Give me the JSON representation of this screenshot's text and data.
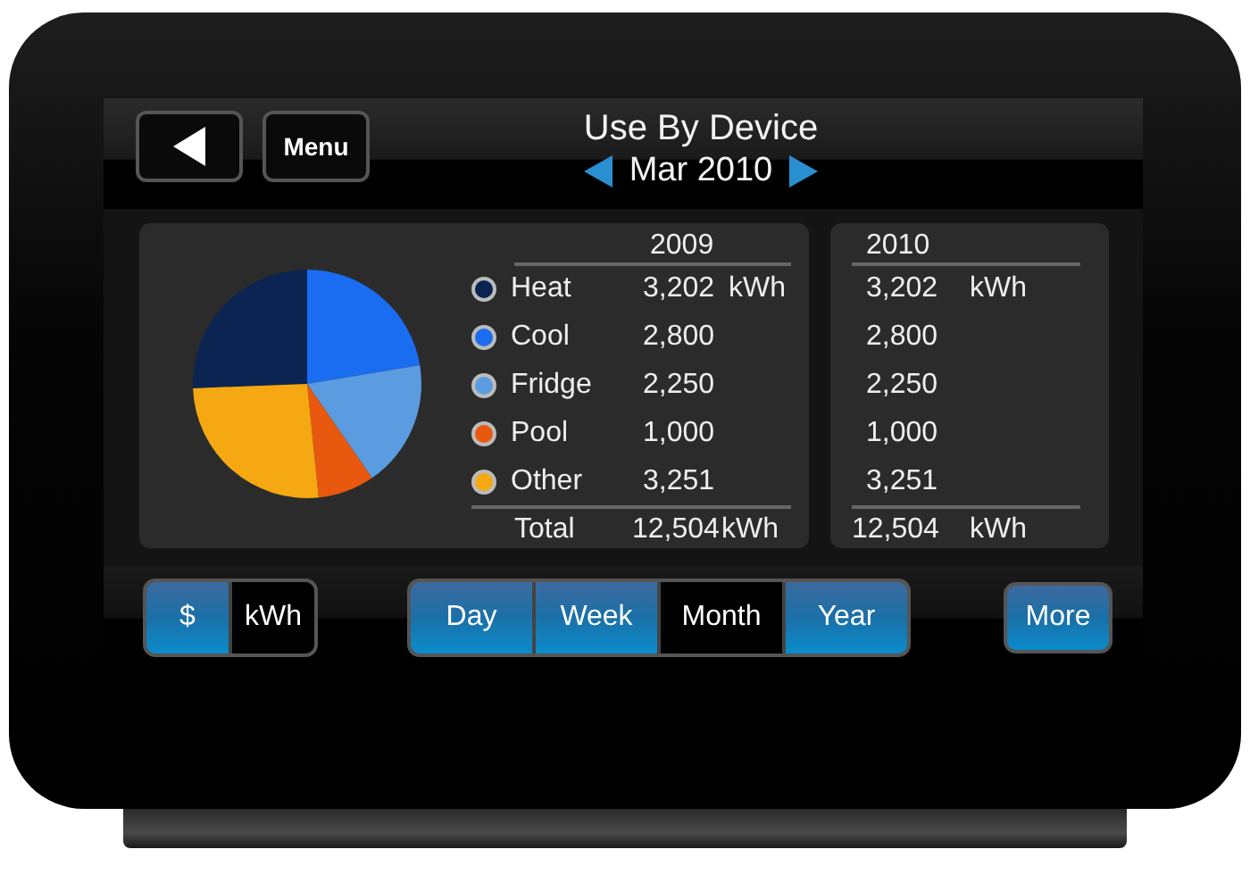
{
  "header": {
    "menu_button": "Menu",
    "title": "Use By Device",
    "period": "Mar 2010"
  },
  "breakdown": {
    "chart_data": {
      "type": "pie",
      "categories": [
        "Heat",
        "Cool",
        "Fridge",
        "Pool",
        "Other"
      ],
      "values": [
        25.61,
        22.39,
        18.0,
        8.0,
        26.0
      ]
    },
    "columns": [
      "2009",
      "2010"
    ],
    "rows": [
      {
        "color": "#0b2452",
        "values": [
          "3,202",
          "3,202"
        ],
        "units": [
          "kWh",
          "kWh"
        ]
      },
      {
        "color": "#1a6cf0",
        "values": [
          "2,800",
          "2,800"
        ]
      },
      {
        "color": "#5b9be0",
        "values": [
          "2,250",
          "2,250"
        ]
      },
      {
        "color": "#e8580f",
        "values": [
          "1,000",
          "1,000"
        ]
      },
      {
        "color": "#f5a811",
        "values": [
          "3,251",
          "3,251"
        ]
      }
    ],
    "total": {
      "label": "Total",
      "values": [
        "12,504",
        "12,504"
      ],
      "units": [
        "kWh",
        "kWh"
      ]
    }
  },
  "unit_toggle": [
    {
      "label": "$",
      "selected": false
    },
    {
      "label": "kWh",
      "selected": true
    }
  ],
  "periods": [
    {
      "label": "Day",
      "selected": false
    },
    {
      "label": "Week",
      "selected": false
    },
    {
      "label": "Month",
      "selected": true
    },
    {
      "label": "Year",
      "selected": false
    }
  ],
  "more_button": "More"
}
